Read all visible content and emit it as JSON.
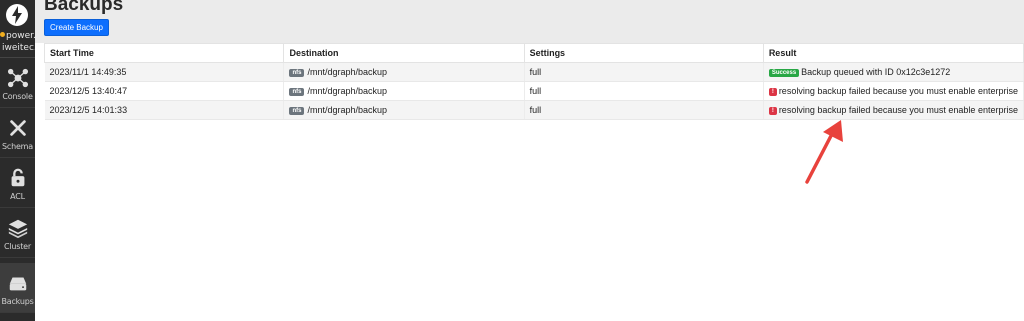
{
  "sidebar": {
    "brand_line_1": "power.la",
    "brand_line_2": "iweitec.c",
    "items": [
      {
        "label": "Console",
        "icon": "network-icon"
      },
      {
        "label": "Schema",
        "icon": "tools-icon"
      },
      {
        "label": "ACL",
        "icon": "lock-icon"
      },
      {
        "label": "Cluster",
        "icon": "layers-icon"
      },
      {
        "label": "Backups",
        "icon": "drive-icon"
      }
    ]
  },
  "header": {
    "title": "Backups",
    "create_label": "Create Backup"
  },
  "table": {
    "columns": [
      "Start Time",
      "Destination",
      "Settings",
      "Result"
    ],
    "rows": [
      {
        "start": "2023/11/1 14:49:35",
        "dest_type": "nfs",
        "dest": "/mnt/dgraph/backup",
        "settings": "full",
        "status": "Success",
        "result": "Backup queued with ID 0x12c3e1272"
      },
      {
        "start": "2023/12/5 13:40:47",
        "dest_type": "nfs",
        "dest": "/mnt/dgraph/backup",
        "settings": "full",
        "status": "!",
        "result": "resolving backup failed because you must enable enterprise"
      },
      {
        "start": "2023/12/5 14:01:33",
        "dest_type": "nfs",
        "dest": "/mnt/dgraph/backup",
        "settings": "full",
        "status": "!",
        "result": "resolving backup failed because you must enable enterprise"
      }
    ]
  },
  "colors": {
    "sidebar_bg": "#2b2b2b",
    "primary": "#0d6efd",
    "success": "#28a745",
    "danger": "#dc3545",
    "annotation_arrow": "#e8423c"
  }
}
